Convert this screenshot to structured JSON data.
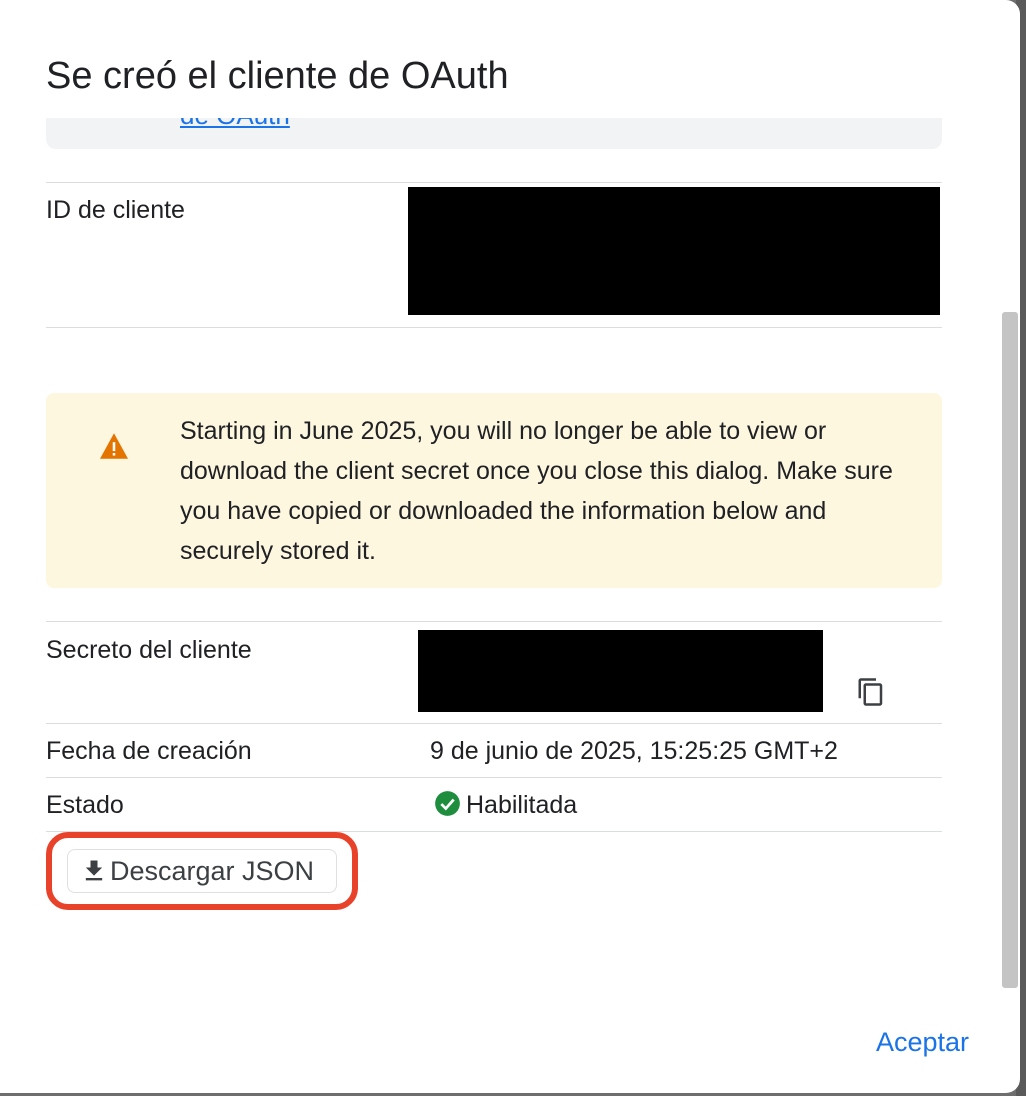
{
  "dialog": {
    "title": "Se creó el cliente de OAuth",
    "info_link_text": "de OAuth"
  },
  "client_id": {
    "label": "ID de cliente"
  },
  "warning": {
    "icon": "warning-triangle-icon",
    "text": "Starting in June 2025, you will no longer be able to view or download the client secret once you close this dialog. Make sure you have copied or downloaded the information below and securely stored it."
  },
  "client_secret": {
    "label": "Secreto del cliente",
    "copy_icon": "copy-icon"
  },
  "created": {
    "label": "Fecha de creación",
    "value": "9 de junio de 2025, 15:25:25 GMT+2"
  },
  "status": {
    "label": "Estado",
    "value": "Habilitada",
    "icon": "check-circle-icon"
  },
  "download": {
    "label": "Descargar JSON",
    "icon": "download-icon"
  },
  "footer": {
    "accept_label": "Aceptar"
  },
  "colors": {
    "accent": "#1a73e8",
    "warning_bg": "#fef7e0",
    "warning_icon": "#e37400",
    "success": "#1e8e3e",
    "highlight": "#e8432a"
  }
}
